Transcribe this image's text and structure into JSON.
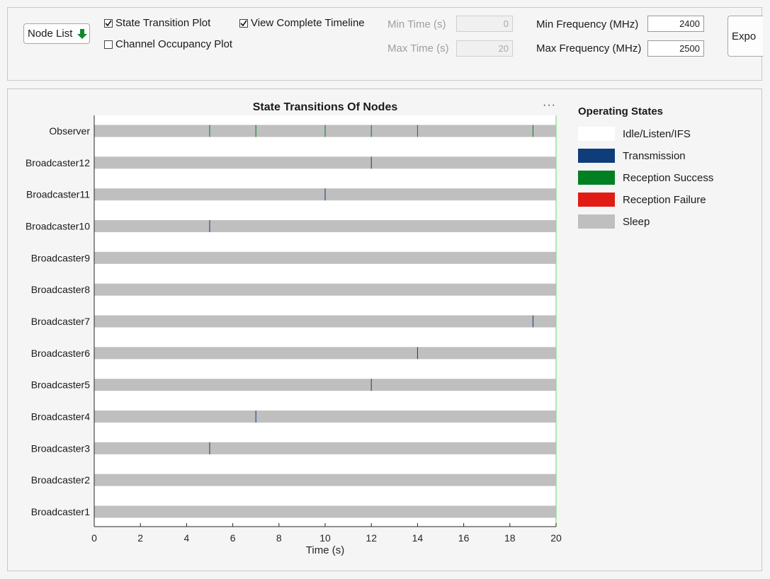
{
  "controls": {
    "node_list_label": "Node List",
    "export_label": "Expo",
    "state_transition_label": "State Transition Plot",
    "state_transition_checked": true,
    "channel_occupancy_label": "Channel Occupancy Plot",
    "channel_occupancy_checked": false,
    "view_timeline_label": "View Complete Timeline",
    "view_timeline_checked": true,
    "min_time_label": "Min Time (s)",
    "min_time_value": "0",
    "max_time_label": "Max Time (s)",
    "max_time_value": "20",
    "min_freq_label": "Min Frequency (MHz)",
    "min_freq_value": "2400",
    "max_freq_label": "Max Frequency (MHz)",
    "max_freq_value": "2500"
  },
  "legend": {
    "title": "Operating States",
    "items": [
      {
        "label": "Idle/Listen/IFS",
        "color": "#ffffff"
      },
      {
        "label": "Transmission",
        "color": "#0f3d7a"
      },
      {
        "label": "Reception Success",
        "color": "#008020"
      },
      {
        "label": "Reception Failure",
        "color": "#e01c14"
      },
      {
        "label": "Sleep",
        "color": "#bfbfbf"
      }
    ]
  },
  "chart_data": {
    "type": "timeline",
    "title": "State Transitions Of Nodes",
    "xlabel": "Time (s)",
    "ylabel": "",
    "xlim": [
      0,
      20
    ],
    "xticks": [
      0,
      2,
      4,
      6,
      8,
      10,
      12,
      14,
      16,
      18,
      20
    ],
    "nodes": [
      {
        "name": "Observer",
        "base_state": "Sleep",
        "events": [
          {
            "time": 5,
            "state": "Reception Success"
          },
          {
            "time": 7,
            "state": "Reception Success"
          },
          {
            "time": 10,
            "state": "Reception Success"
          },
          {
            "time": 12,
            "state": "Reception Success"
          },
          {
            "time": 14,
            "state": "Reception Success"
          },
          {
            "time": 19,
            "state": "Reception Success"
          }
        ]
      },
      {
        "name": "Broadcaster12",
        "base_state": "Sleep",
        "events": [
          {
            "time": 12,
            "state": "Transmission"
          }
        ]
      },
      {
        "name": "Broadcaster11",
        "base_state": "Sleep",
        "events": [
          {
            "time": 10,
            "state": "Transmission"
          }
        ]
      },
      {
        "name": "Broadcaster10",
        "base_state": "Sleep",
        "events": [
          {
            "time": 5,
            "state": "Transmission"
          }
        ]
      },
      {
        "name": "Broadcaster9",
        "base_state": "Sleep",
        "events": []
      },
      {
        "name": "Broadcaster8",
        "base_state": "Sleep",
        "events": []
      },
      {
        "name": "Broadcaster7",
        "base_state": "Sleep",
        "events": [
          {
            "time": 19,
            "state": "Transmission"
          }
        ]
      },
      {
        "name": "Broadcaster6",
        "base_state": "Sleep",
        "events": [
          {
            "time": 14,
            "state": "Transmission"
          }
        ]
      },
      {
        "name": "Broadcaster5",
        "base_state": "Sleep",
        "events": [
          {
            "time": 12,
            "state": "Transmission"
          }
        ]
      },
      {
        "name": "Broadcaster4",
        "base_state": "Sleep",
        "events": [
          {
            "time": 7,
            "state": "Transmission"
          }
        ]
      },
      {
        "name": "Broadcaster3",
        "base_state": "Sleep",
        "events": [
          {
            "time": 5,
            "state": "Transmission"
          }
        ]
      },
      {
        "name": "Broadcaster2",
        "base_state": "Sleep",
        "events": []
      },
      {
        "name": "Broadcaster1",
        "base_state": "Sleep",
        "events": []
      }
    ],
    "grid": false,
    "legend_position": "right"
  }
}
